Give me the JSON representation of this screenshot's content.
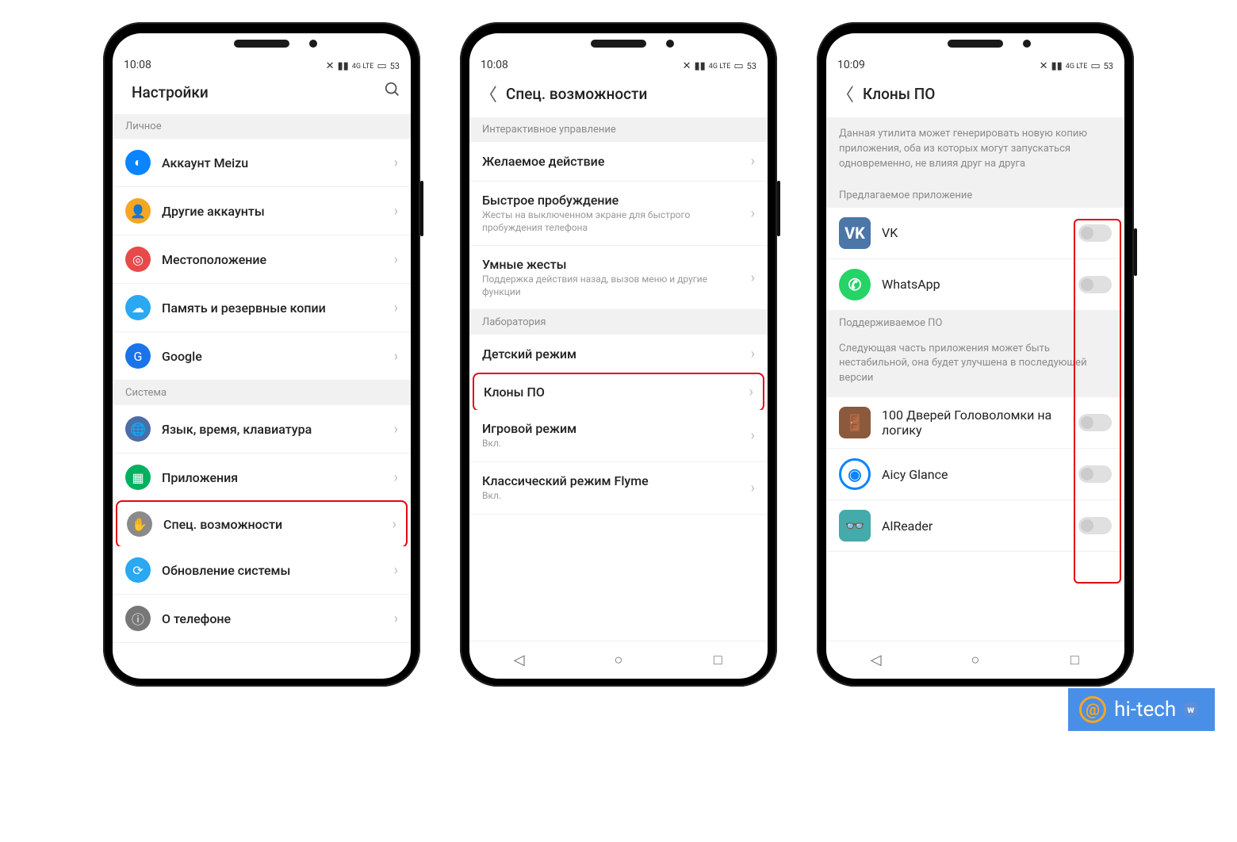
{
  "status": {
    "time1": "10:08",
    "time2": "10:08",
    "time3": "10:09",
    "battery": "53",
    "net": "4G LTE"
  },
  "p1": {
    "title": "Настройки",
    "sec_personal": "Личное",
    "sec_system": "Система",
    "items_personal": [
      {
        "label": "Аккаунт Meizu",
        "iconColor": "#0a84ff",
        "glyph": "◐"
      },
      {
        "label": "Другие аккаунты",
        "iconColor": "#f5a623",
        "glyph": "👤"
      },
      {
        "label": "Местоположение",
        "iconColor": "#e64a4a",
        "glyph": "◎"
      },
      {
        "label": "Память и резервные копии",
        "iconColor": "#2aa8f2",
        "glyph": "☁"
      },
      {
        "label": "Google",
        "iconColor": "#1a73e8",
        "glyph": "G"
      }
    ],
    "items_system": [
      {
        "label": "Язык, время, клавиатура",
        "iconColor": "#4a6ea8",
        "glyph": "🌐"
      },
      {
        "label": "Приложения",
        "iconColor": "#00b060",
        "glyph": "▦"
      },
      {
        "label": "Спец. возможности",
        "iconColor": "#8a8a8a",
        "glyph": "✋",
        "highlight": true
      },
      {
        "label": "Обновление системы",
        "iconColor": "#2aa8f2",
        "glyph": "⟳"
      },
      {
        "label": "О телефоне",
        "iconColor": "#777",
        "glyph": "ⓘ"
      }
    ]
  },
  "p2": {
    "title": "Спец. возможности",
    "sec_interactive": "Интерактивное управление",
    "sec_lab": "Лаборатория",
    "items_interactive": [
      {
        "label": "Желаемое действие"
      },
      {
        "label": "Быстрое пробуждение",
        "sub": "Жесты на выключенном экране для быстрого пробуждения телефона"
      },
      {
        "label": "Умные жесты",
        "sub": "Поддержка действия назад, вызов меню и другие функции"
      }
    ],
    "items_lab": [
      {
        "label": "Детский режим"
      },
      {
        "label": "Клоны ПО",
        "highlight": true
      },
      {
        "label": "Игровой режим",
        "sub": "Вкл."
      },
      {
        "label": "Классический режим Flyme",
        "sub": "Вкл."
      }
    ]
  },
  "p3": {
    "title": "Клоны ПО",
    "desc_top": "Данная утилита может генерировать новую копию приложения, оба из которых могут запускаться одновременно, не влияя друг на друга",
    "sec_suggested": "Предлагаемое приложение",
    "sec_supported": "Поддерживаемое ПО",
    "desc_supported": "Следующая часть приложения может быть нестабильной, она будет улучшена в последующей версии",
    "apps_suggested": [
      {
        "label": "VK",
        "bg": "#4a76a8",
        "glyph": "VK"
      },
      {
        "label": "WhatsApp",
        "bg": "#25d366",
        "glyph": "✆",
        "round": true
      }
    ],
    "apps_supported": [
      {
        "label": "100 Дверей Головоломки на логику",
        "bg": "#8b5a3c",
        "glyph": "🚪"
      },
      {
        "label": "Aicy Glance",
        "bg": "#fff",
        "glyph": "◉",
        "ring": "#0a84ff"
      },
      {
        "label": "AlReader",
        "bg": "#4aa",
        "glyph": "👓"
      }
    ]
  },
  "watermark": "hi-tech"
}
